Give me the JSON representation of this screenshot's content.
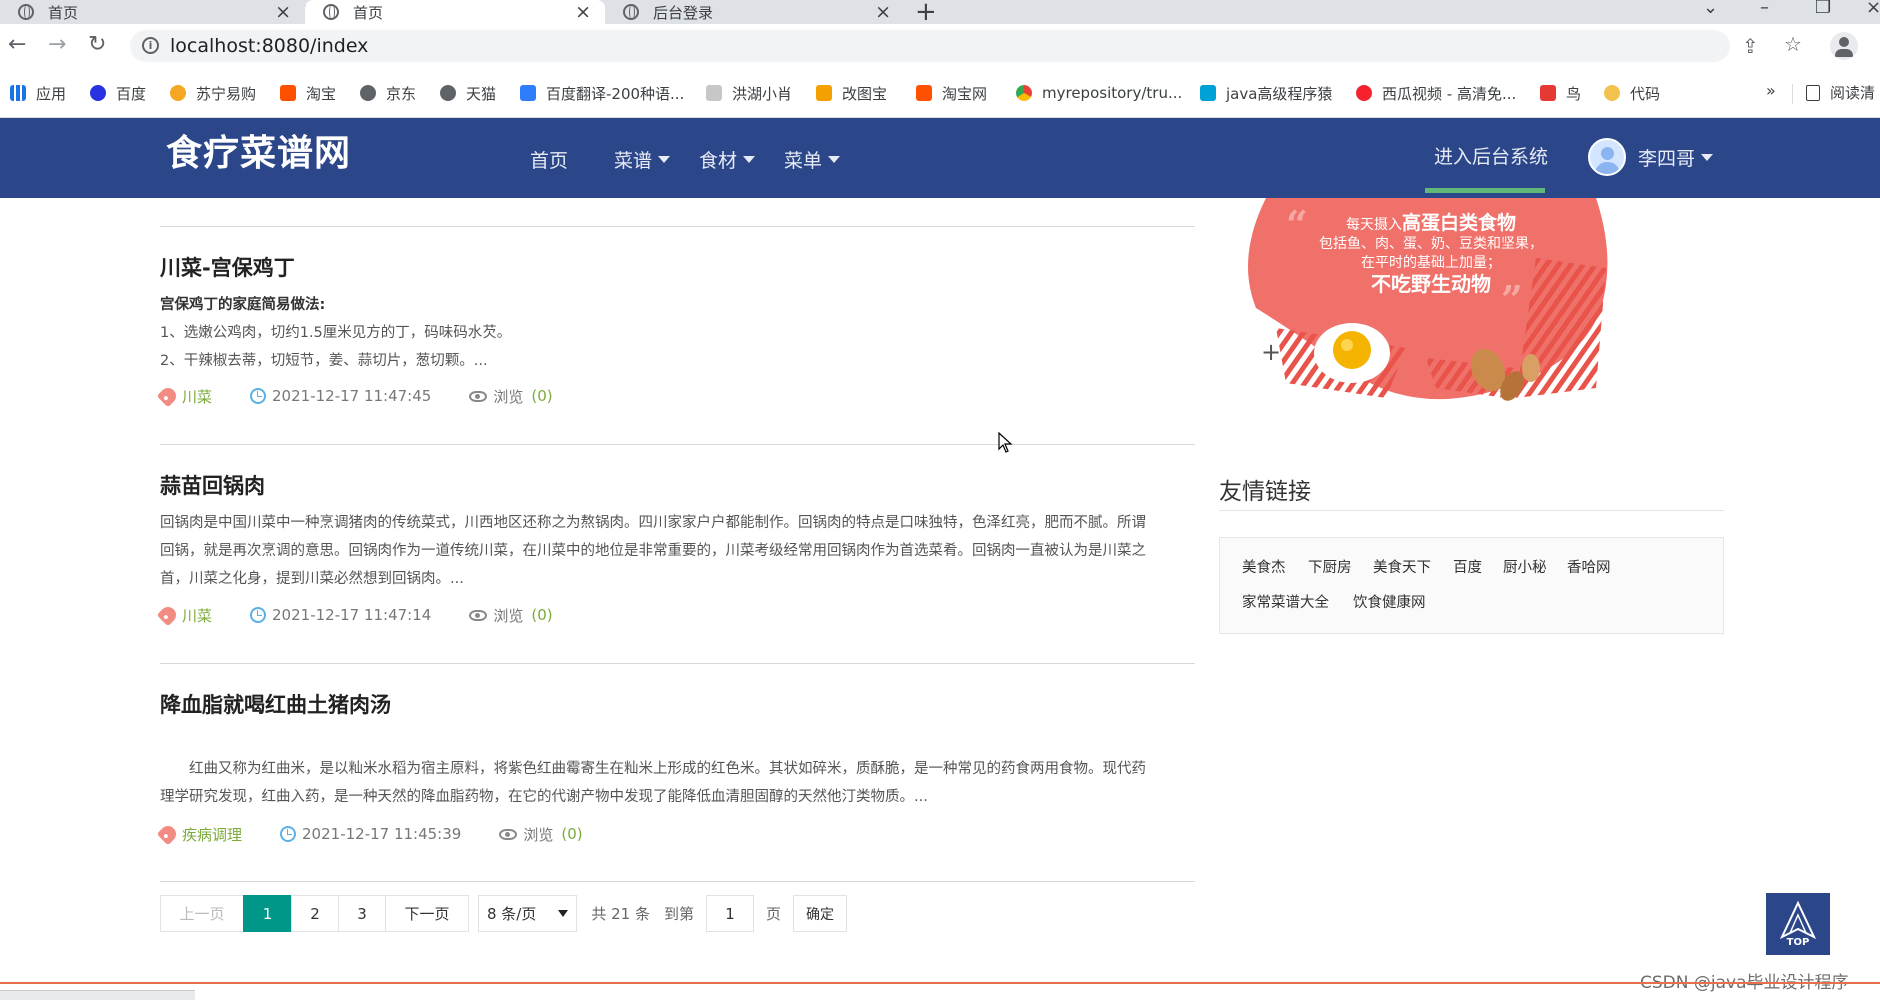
{
  "browser": {
    "tabs": [
      {
        "title": "首页",
        "active": false
      },
      {
        "title": "首页",
        "active": true
      },
      {
        "title": "后台登录",
        "active": false
      }
    ],
    "url": "localhost:8080/index",
    "bookmarks": [
      {
        "label": "应用",
        "icon": "apps-grid-icon",
        "color": "#1a73e8"
      },
      {
        "label": "百度",
        "icon": "baidu-paw-icon",
        "color": "#2932e1"
      },
      {
        "label": "苏宁易购",
        "icon": "suning-icon",
        "color": "#f5a623"
      },
      {
        "label": "淘宝",
        "icon": "taobao-icon",
        "color": "#ff5000"
      },
      {
        "label": "京东",
        "icon": "globe-icon",
        "color": "#5f6368"
      },
      {
        "label": "天猫",
        "icon": "globe-icon",
        "color": "#5f6368"
      },
      {
        "label": "百度翻译-200种语...",
        "icon": "baidu-translate-icon",
        "color": "#2f7dfc"
      },
      {
        "label": "洪湖小肖",
        "icon": "bird-icon",
        "color": "#8a8a8a"
      },
      {
        "label": "改图宝",
        "icon": "gaitubao-icon",
        "color": "#f4a000"
      },
      {
        "label": "淘宝网",
        "icon": "taobao-icon",
        "color": "#ff5000"
      },
      {
        "label": "myrepository/tru...",
        "icon": "chrome-icon",
        "color": "#34a853"
      },
      {
        "label": "java高级程序猿",
        "icon": "bilibili-icon",
        "color": "#00a1d6"
      },
      {
        "label": "西瓜视频 - 高清免...",
        "icon": "xigua-icon",
        "color": "#f5222d"
      },
      {
        "label": "鸟",
        "icon": "bird-icon",
        "color": "#e53935"
      },
      {
        "label": "代码",
        "icon": "code-icon",
        "color": "#f2c14e"
      }
    ],
    "more": "»",
    "reading_list": "阅读清"
  },
  "site": {
    "logo": "食疗菜谱网",
    "nav": [
      {
        "label": "首页",
        "dropdown": false
      },
      {
        "label": "菜谱",
        "dropdown": true
      },
      {
        "label": "食材",
        "dropdown": true
      },
      {
        "label": "菜单",
        "dropdown": true
      }
    ],
    "admin_link": "进入后台系统",
    "user_name": "李四哥",
    "colors": {
      "navbar": "#2b4689",
      "accent": "#009688",
      "underline": "#5fb878",
      "tag": "#7cab3c"
    }
  },
  "articles": [
    {
      "title": "川菜-宫保鸡丁",
      "intro": "宫保鸡丁的家庭简易做法:",
      "lines": [
        "1、选嫩公鸡肉，切约1.5厘米见方的丁，码味码水芡。",
        "2、干辣椒去蒂，切短节，姜、蒜切片，葱切颗。..."
      ],
      "tag": "川菜",
      "date": "2021-12-17 11:47:45",
      "view_label": "浏览",
      "views": "(0)"
    },
    {
      "title": "蒜苗回锅肉",
      "intro": "",
      "lines": [
        "回锅肉是中国川菜中一种烹调猪肉的传统菜式，川西地区还称之为熬锅肉。四川家家户户都能制作。回锅肉的特点是口味独特，色泽红亮，肥而不腻。所谓",
        "回锅，就是再次烹调的意思。回锅肉作为一道传统川菜，在川菜中的地位是非常重要的，川菜考级经常用回锅肉作为首选菜肴。回锅肉一直被认为是川菜之",
        "首，川菜之化身，提到川菜必然想到回锅肉。..."
      ],
      "tag": "川菜",
      "date": "2021-12-17 11:47:14",
      "view_label": "浏览",
      "views": "(0)"
    },
    {
      "title": "降血脂就喝红曲土猪肉汤",
      "intro": "",
      "lines": [
        "　　红曲又称为红曲米，是以籼米水稻为宿主原料，将紫色红曲霉寄生在籼米上形成的红色米。其状如碎米，质酥脆，是一种常见的药食两用食物。现代药",
        "理学研究发现，红曲入药，是一种天然的降血脂药物，在它的代谢产物中发现了能降低血清胆固醇的天然他汀类物质。..."
      ],
      "tag": "疾病调理",
      "date": "2021-12-17 11:45:39",
      "view_label": "浏览",
      "views": "(0)"
    }
  ],
  "pagination": {
    "prev": "上一页",
    "pages": [
      "1",
      "2",
      "3"
    ],
    "current": "1",
    "next": "下一页",
    "per_page": "8 条/页",
    "total": "共 21 条",
    "goto_label": "到第",
    "goto_value": "1",
    "page_unit": "页",
    "confirm": "确定"
  },
  "banner": {
    "line1_small": "每天摄入",
    "line1_big": "高蛋白类食物",
    "line2": "包括鱼、肉、蛋、奶、豆类和坚果，",
    "line3": "在平时的基础上加量；",
    "line4": "不吃野生动物"
  },
  "friends": {
    "title": "友情链接",
    "links": [
      "美食杰",
      "下厨房",
      "美食天下",
      "百度",
      "厨小秘",
      "香哈网",
      "家常菜谱大全",
      "饮食健康网"
    ]
  },
  "back_to_top": "TOP",
  "watermark": "CSDN @java毕业设计程序"
}
